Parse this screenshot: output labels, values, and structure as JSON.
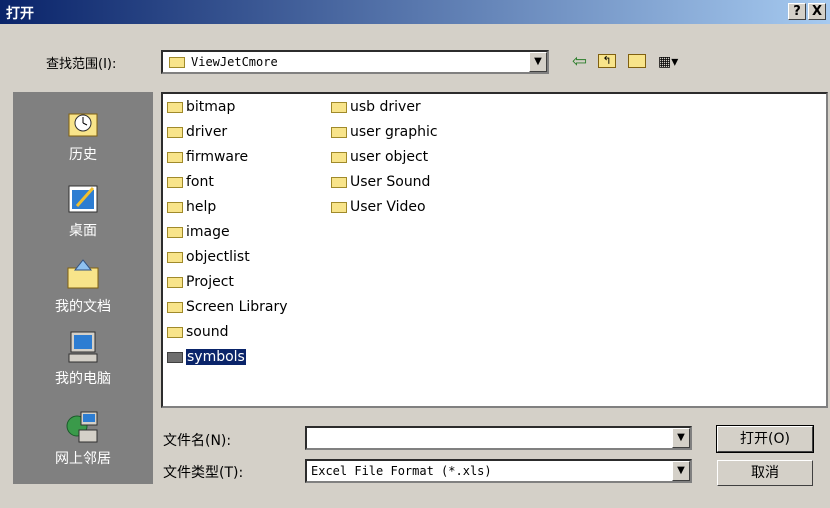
{
  "window": {
    "title": "打开",
    "help_label": "?",
    "close_label": "X"
  },
  "lookin": {
    "label": "查找范围(I):",
    "value": "ViewJetCmore"
  },
  "toolbar": {
    "back_icon": "back-arrow-icon",
    "up_icon": "up-folder-icon",
    "new_folder_icon": "new-folder-icon",
    "views_icon": "views-menu-icon"
  },
  "places": [
    {
      "label": "历史",
      "icon": "history-icon"
    },
    {
      "label": "桌面",
      "icon": "desktop-icon"
    },
    {
      "label": "我的文档",
      "icon": "my-documents-icon"
    },
    {
      "label": "我的电脑",
      "icon": "my-computer-icon"
    },
    {
      "label": "网上邻居",
      "icon": "network-icon"
    }
  ],
  "files_col1": [
    "bitmap",
    "driver",
    "firmware",
    "font",
    "help",
    "image",
    "objectlist",
    "Project",
    "Screen Library",
    "sound",
    "symbols"
  ],
  "files_col2": [
    "usb driver",
    "user graphic",
    "user object",
    "User Sound",
    "User Video"
  ],
  "selected_file": "symbols",
  "filename": {
    "label": "文件名(N):",
    "value": ""
  },
  "filetype": {
    "label": "文件类型(T):",
    "value": "Excel File Format (*.xls)"
  },
  "buttons": {
    "open": "打开(O)",
    "cancel": "取消"
  }
}
